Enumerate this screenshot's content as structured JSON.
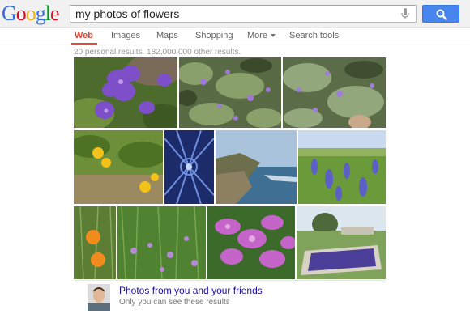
{
  "header": {
    "logo_letters": [
      "G",
      "o",
      "o",
      "g",
      "l",
      "e"
    ],
    "search": {
      "value": "my photos of flowers",
      "placeholder": ""
    }
  },
  "nav": {
    "tabs": [
      {
        "label": "Web",
        "active": true
      },
      {
        "label": "Images",
        "active": false
      },
      {
        "label": "Maps",
        "active": false
      },
      {
        "label": "Shopping",
        "active": false
      },
      {
        "label": "More",
        "active": false
      },
      {
        "label": "Search tools",
        "active": false
      }
    ]
  },
  "results": {
    "stats": "20 personal results. 182,000,000 other results."
  },
  "photos": [
    {
      "subject": "purple flowers close-up"
    },
    {
      "subject": "garden shrub with small purple flowers"
    },
    {
      "subject": "purple flowering bush"
    },
    {
      "subject": "yellow poppies in grass"
    },
    {
      "subject": "blue geometric ceiling"
    },
    {
      "subject": "coastal cliffs and ocean"
    },
    {
      "subject": "blue lupine field"
    },
    {
      "subject": "orange poppies"
    },
    {
      "subject": "wild irises in meadow"
    },
    {
      "subject": "pink irises close-up"
    },
    {
      "subject": "formal garden with purple flower bed"
    }
  ],
  "friends": {
    "title": "Photos from you and your friends",
    "subtitle": "Only you can see these results"
  },
  "colors": {
    "accent_red": "#dd4b39",
    "link_blue": "#1a0dab",
    "button_blue": "#4885ed"
  }
}
